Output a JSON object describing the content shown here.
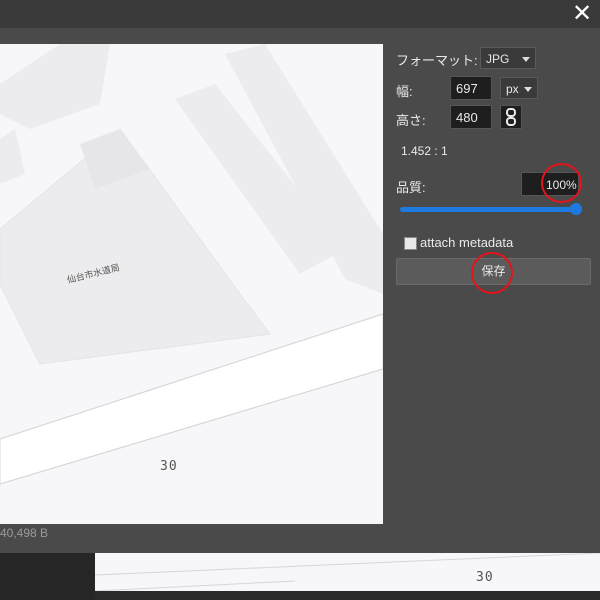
{
  "dialog": {
    "close_icon": "close-icon",
    "filesize_label": "40,498 B"
  },
  "map": {
    "building_label": "仙台市水道局",
    "road_number": "30"
  },
  "panel": {
    "format_label": "フォーマット:",
    "format_value": "JPG",
    "width_label": "幅:",
    "width_value": "697",
    "unit_value": "px",
    "height_label": "高さ:",
    "height_value": "480",
    "ratio_text": "1.452 : 1",
    "quality_label": "品質:",
    "quality_value": "100%",
    "quality_fraction": 1.0,
    "metadata_label": "attach metadata",
    "save_label": "保存"
  },
  "background_map": {
    "road_number": "30"
  },
  "colors": {
    "accent": "#1f7ae0",
    "highlight_circle": "#e3141b"
  }
}
